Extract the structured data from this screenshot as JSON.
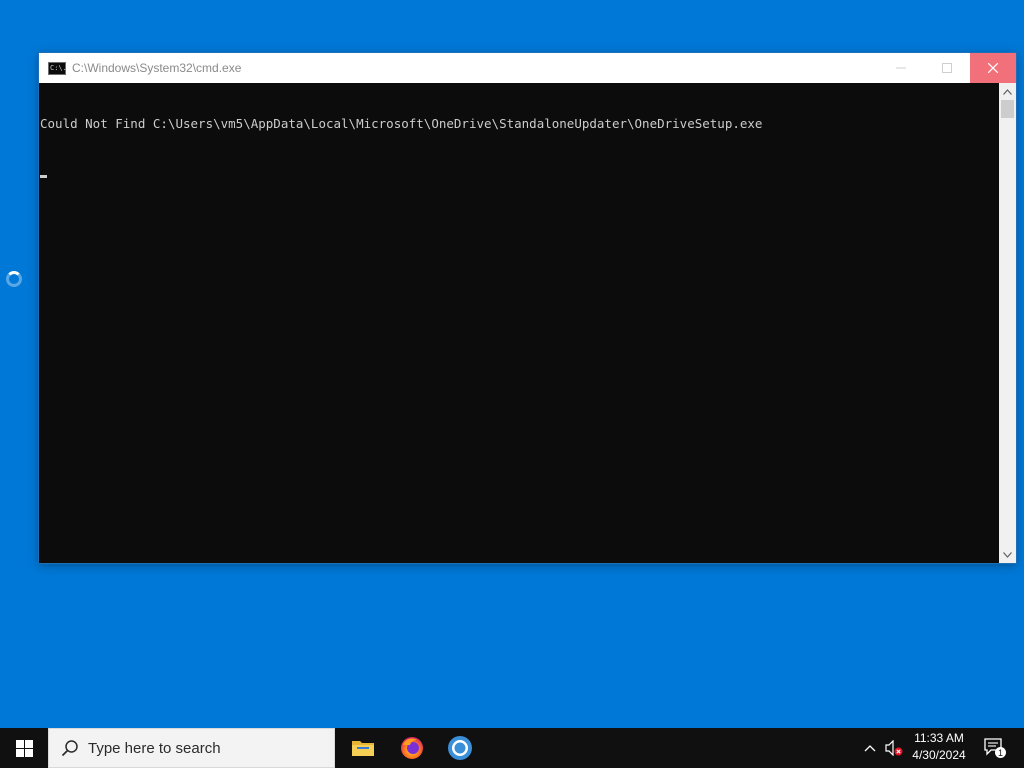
{
  "desktop": {
    "busy_indicator": "spinner-icon"
  },
  "window": {
    "title": "C:\\Windows\\System32\\cmd.exe",
    "app_icon_text": "C:\\.",
    "controls": {
      "minimize_icon": "minimize-icon",
      "maximize_icon": "maximize-icon",
      "close_icon": "close-icon",
      "close_hover_color": "#f1707a"
    },
    "console": {
      "lines": [
        "Could Not Find C:\\Users\\vm5\\AppData\\Local\\Microsoft\\OneDrive\\StandaloneUpdater\\OneDriveSetup.exe"
      ],
      "background": "#0c0c0c",
      "foreground": "#cccccc"
    }
  },
  "taskbar": {
    "start_icon": "windows-logo-icon",
    "search": {
      "placeholder": "Type here to search",
      "icon": "search-icon"
    },
    "pinned_apps": [
      {
        "name": "File Explorer",
        "icon": "folder-icon"
      },
      {
        "name": "Firefox",
        "icon": "firefox-icon"
      },
      {
        "name": "Chrome",
        "icon": "chrome-icon"
      }
    ],
    "tray": {
      "show_hidden_icon": "chevron-up-icon",
      "volume_icon": "volume-muted-icon",
      "time": "11:33 AM",
      "date": "4/30/2024",
      "notifications_icon": "notification-icon",
      "notification_count": "1"
    }
  },
  "colors": {
    "desktop": "#0078d7",
    "taskbar": "#101010"
  }
}
